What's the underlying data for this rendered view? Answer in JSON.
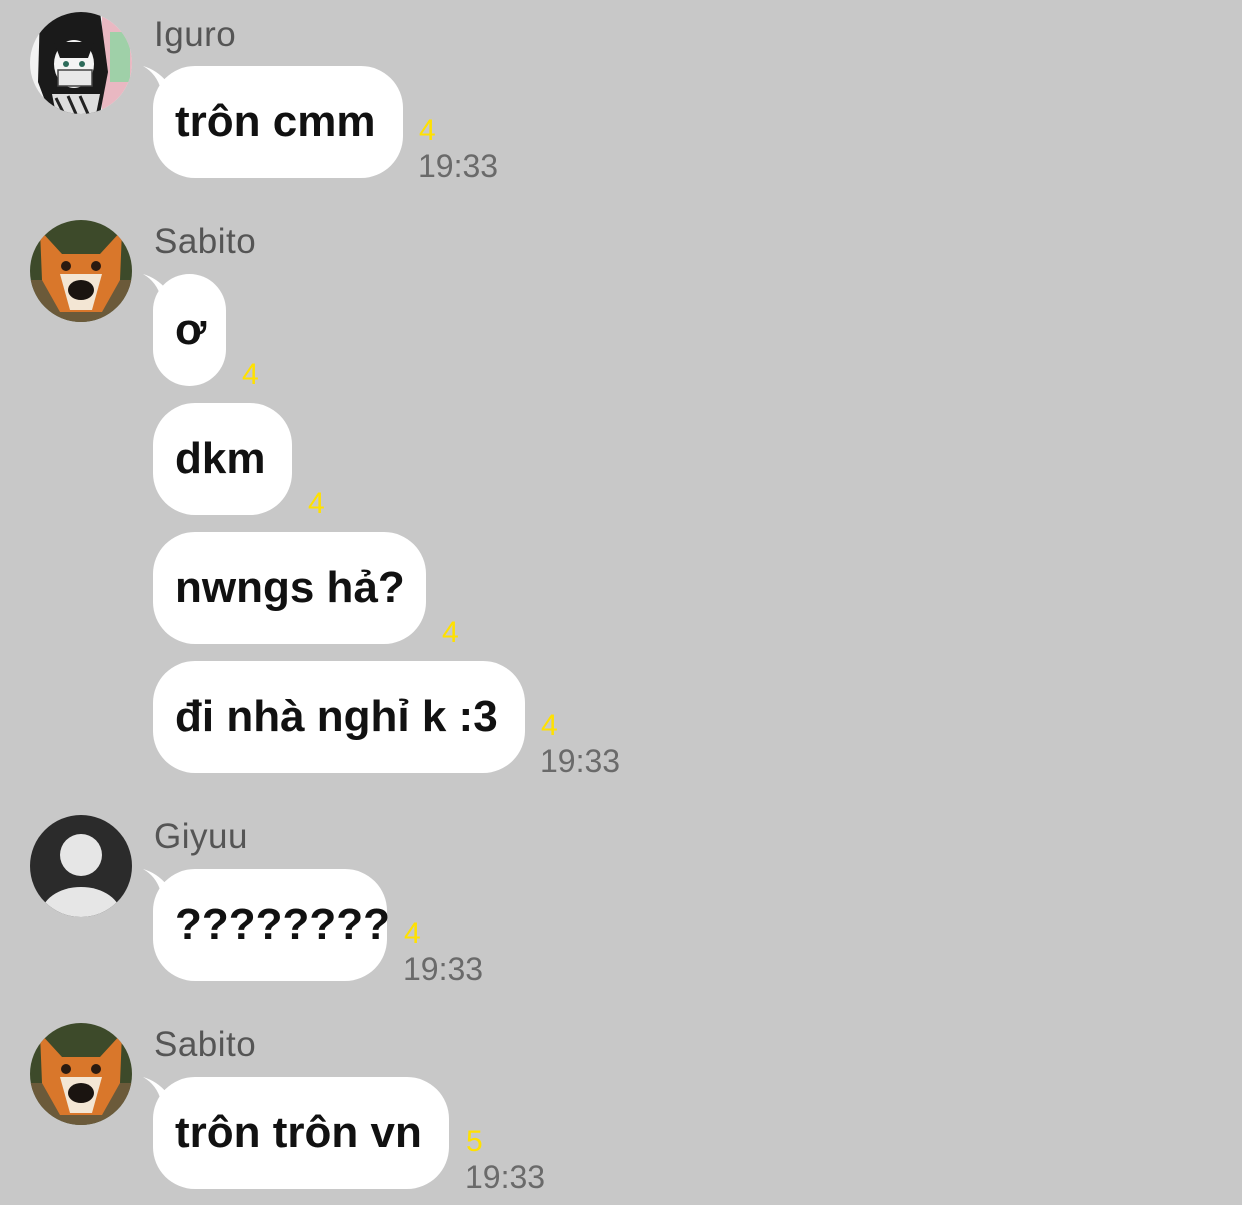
{
  "messages_group_1": {
    "sender": "Iguro",
    "messages": [
      {
        "text": "trôn cmm",
        "unread": "4",
        "time": "19:33"
      }
    ]
  },
  "messages_group_2": {
    "sender": "Sabito",
    "messages": [
      {
        "text": "ơ",
        "unread": "4"
      },
      {
        "text": "dkm",
        "unread": "4"
      },
      {
        "text": "nwngs hả?",
        "unread": "4"
      },
      {
        "text": "đi nhà nghỉ k :3",
        "unread": "4",
        "time": "19:33"
      }
    ]
  },
  "messages_group_3": {
    "sender": "Giyuu",
    "messages": [
      {
        "text": "????????",
        "unread": "4",
        "time": "19:33"
      }
    ]
  },
  "messages_group_4": {
    "sender": "Sabito",
    "messages": [
      {
        "text": "trôn trôn vn",
        "unread": "5",
        "time": "19:33"
      }
    ]
  },
  "colors": {
    "background": "#c8c8c8",
    "bubble": "#ffffff",
    "unread": "#ffe100",
    "time": "#6a6a6a"
  }
}
